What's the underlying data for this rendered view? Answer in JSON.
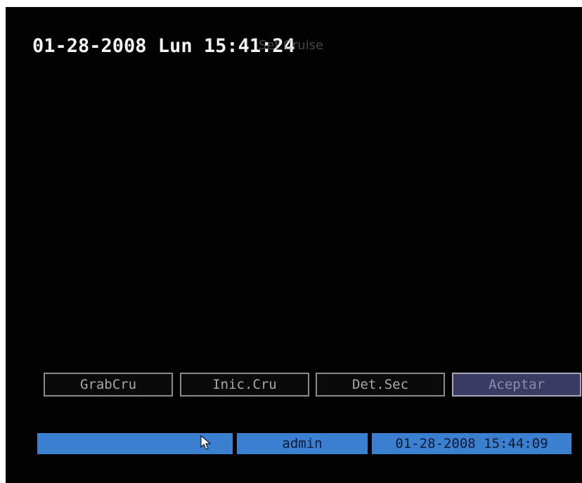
{
  "osd": {
    "timestamp": "01-28-2008 Lun 15:41:24",
    "ghost_text": "Set Cruise"
  },
  "buttons": [
    {
      "label": "GrabCru"
    },
    {
      "label": "Inic.Cru"
    },
    {
      "label": "Det.Sec"
    },
    {
      "label": "Aceptar"
    }
  ],
  "statusbar": {
    "cursor_icon": "mouse-pointer-icon",
    "user": "admin",
    "datetime": "01-28-2008 15:44:09"
  },
  "colors": {
    "background": "#020202",
    "statusbar": "#3b7fd0",
    "active_button": "#3a3b63"
  }
}
